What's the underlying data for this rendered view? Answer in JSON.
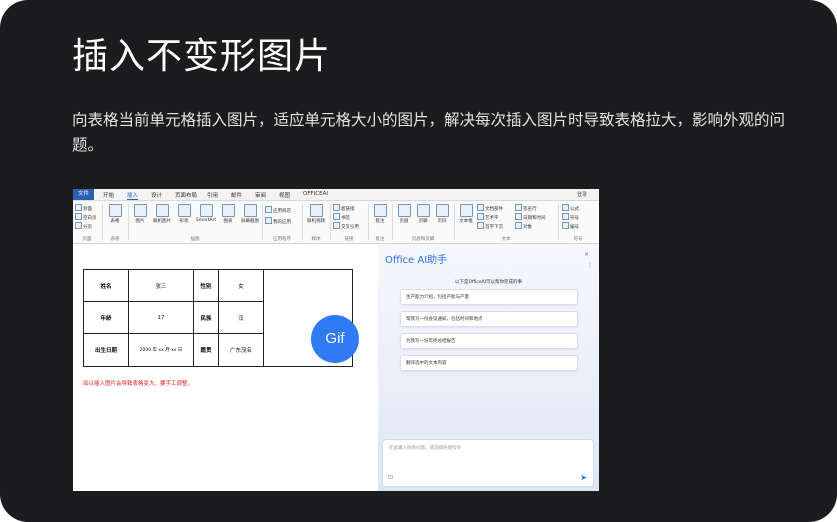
{
  "card": {
    "title": "插入不变形图片",
    "description": "向表格当前单元格插入图片，适应单元格大小的图片，解决每次插入图片时导致表格拉大，影响外观的问题。"
  },
  "screenshot": {
    "ribbon_tabs": [
      "文件",
      "开始",
      "插入",
      "设计",
      "页面布局",
      "引用",
      "邮件",
      "审阅",
      "视图",
      "OFFICEAI"
    ],
    "active_tab": "插入",
    "account_label": "登录",
    "ribbon_groups": [
      {
        "label": "页面",
        "items": [
          "封面",
          "空白页",
          "分页"
        ]
      },
      {
        "label": "表格",
        "items": [
          "表格"
        ]
      },
      {
        "label": "插图",
        "items": [
          "图片",
          "联机图片",
          "形状",
          "SmartArt",
          "图表",
          "屏幕截图"
        ]
      },
      {
        "label": "应用程序",
        "items": [
          "应用商店",
          "我的应用"
        ]
      },
      {
        "label": "媒体",
        "items": [
          "联机视频"
        ]
      },
      {
        "label": "链接",
        "items": [
          "超链接",
          "书签",
          "交叉引用"
        ]
      },
      {
        "label": "批注",
        "items": [
          "批注"
        ]
      },
      {
        "label": "页眉和页脚",
        "items": [
          "页眉",
          "页脚",
          "页码"
        ]
      },
      {
        "label": "文本",
        "items": [
          "文本框",
          "文档部件",
          "艺术字",
          "首字下沉",
          "签名行",
          "日期和时间",
          "对象"
        ]
      },
      {
        "label": "符号",
        "items": [
          "公式",
          "符号",
          "编号"
        ]
      }
    ],
    "document": {
      "table": {
        "rows": [
          [
            "姓名",
            "张三",
            "性别",
            "女"
          ],
          [
            "年龄",
            "17",
            "民族",
            "汉"
          ],
          [
            "出生日期",
            "2000 年 xx 月 xx 日",
            "籍贯",
            "广东茂名"
          ]
        ]
      },
      "note": "如以插入图片会导致表格变大，要手工调整。",
      "gif_badge": "Gif"
    },
    "ai_panel": {
      "title": "Office AI助手",
      "close_label": "×",
      "hint": "以下是OfficeAI可以帮你完成的事",
      "suggestions": [
        "生产能力介绍，包括产能与产量",
        "帮我写一份会议通知，包括时间和地点",
        "为我写一份年终总结报告",
        "翻译选中的文本内容"
      ],
      "input_placeholder": "在此输入你的问题，或选择快捷指令",
      "attach_icon": "attachment-icon",
      "send_icon": "send-icon"
    },
    "colors": {
      "accent": "#2b5fb3",
      "gif_badge": "#2f7bf5",
      "note": "#e02020"
    }
  }
}
